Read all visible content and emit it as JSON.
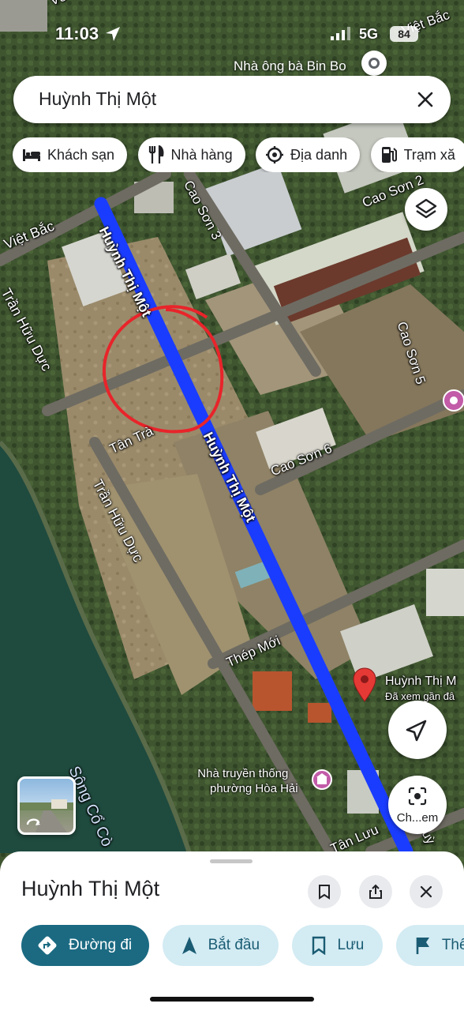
{
  "status_bar": {
    "time": "11:03",
    "network": "5G",
    "battery": "84"
  },
  "search": {
    "query": "Huỳnh Thị Một"
  },
  "chips": [
    {
      "label": "Khách sạn",
      "icon": "bed-icon"
    },
    {
      "label": "Nhà hàng",
      "icon": "restaurant-icon"
    },
    {
      "label": "Địa danh",
      "icon": "landmark-icon"
    },
    {
      "label": "Trạm xă",
      "icon": "gas-station-icon"
    }
  ],
  "map": {
    "top_poi": "Nhà ông bà Bin Bo",
    "pin_title": "Huỳnh Thị M",
    "pin_subtitle": "Đã xem gần đâ",
    "poi_museum": [
      "Nhà truyền thống",
      "phường Hòa Hải"
    ],
    "streets": {
      "vo": "Võ C",
      "viet_bac_top": "Việt Bắc",
      "viet_bac_left": "Việt Bắc",
      "cao_son_2": "Cao Sơn 2",
      "cao_son_3": "Cao Sơn 3",
      "cao_son_5": "Cao Sơn 5",
      "cao_son_6": "Cao Sơn 6",
      "huynh_thi_mot_1": "Huỳnh Thị Một",
      "huynh_thi_mot_2": "Huỳnh Thị Một",
      "tran_huu_duc_1": "Trần Hữu Dực",
      "tran_huu_duc_2": "Trần Hữu Dực",
      "tan_tra": "Tân Trà",
      "thep_moi": "Thép Mới",
      "tan_luu": "Tân Lưu",
      "song_co_co": "Sông Cổ Cò",
      "edge_t": "T",
      "edge_uy": "uỳ"
    },
    "route_color": "#1a3cff",
    "highlight_circle_color": "#e8242a",
    "pin_color": "#e53935"
  },
  "buttons": {
    "lens_label": "Ch...em"
  },
  "place": {
    "title": "Huỳnh Thị Một",
    "actions": [
      {
        "label": "Đường đi",
        "icon": "directions-icon"
      },
      {
        "label": "Bắt đầu",
        "icon": "navigation-arrow-icon"
      },
      {
        "label": "Lưu",
        "icon": "bookmark-icon"
      },
      {
        "label": "Thêm",
        "icon": "flag-icon"
      }
    ]
  }
}
